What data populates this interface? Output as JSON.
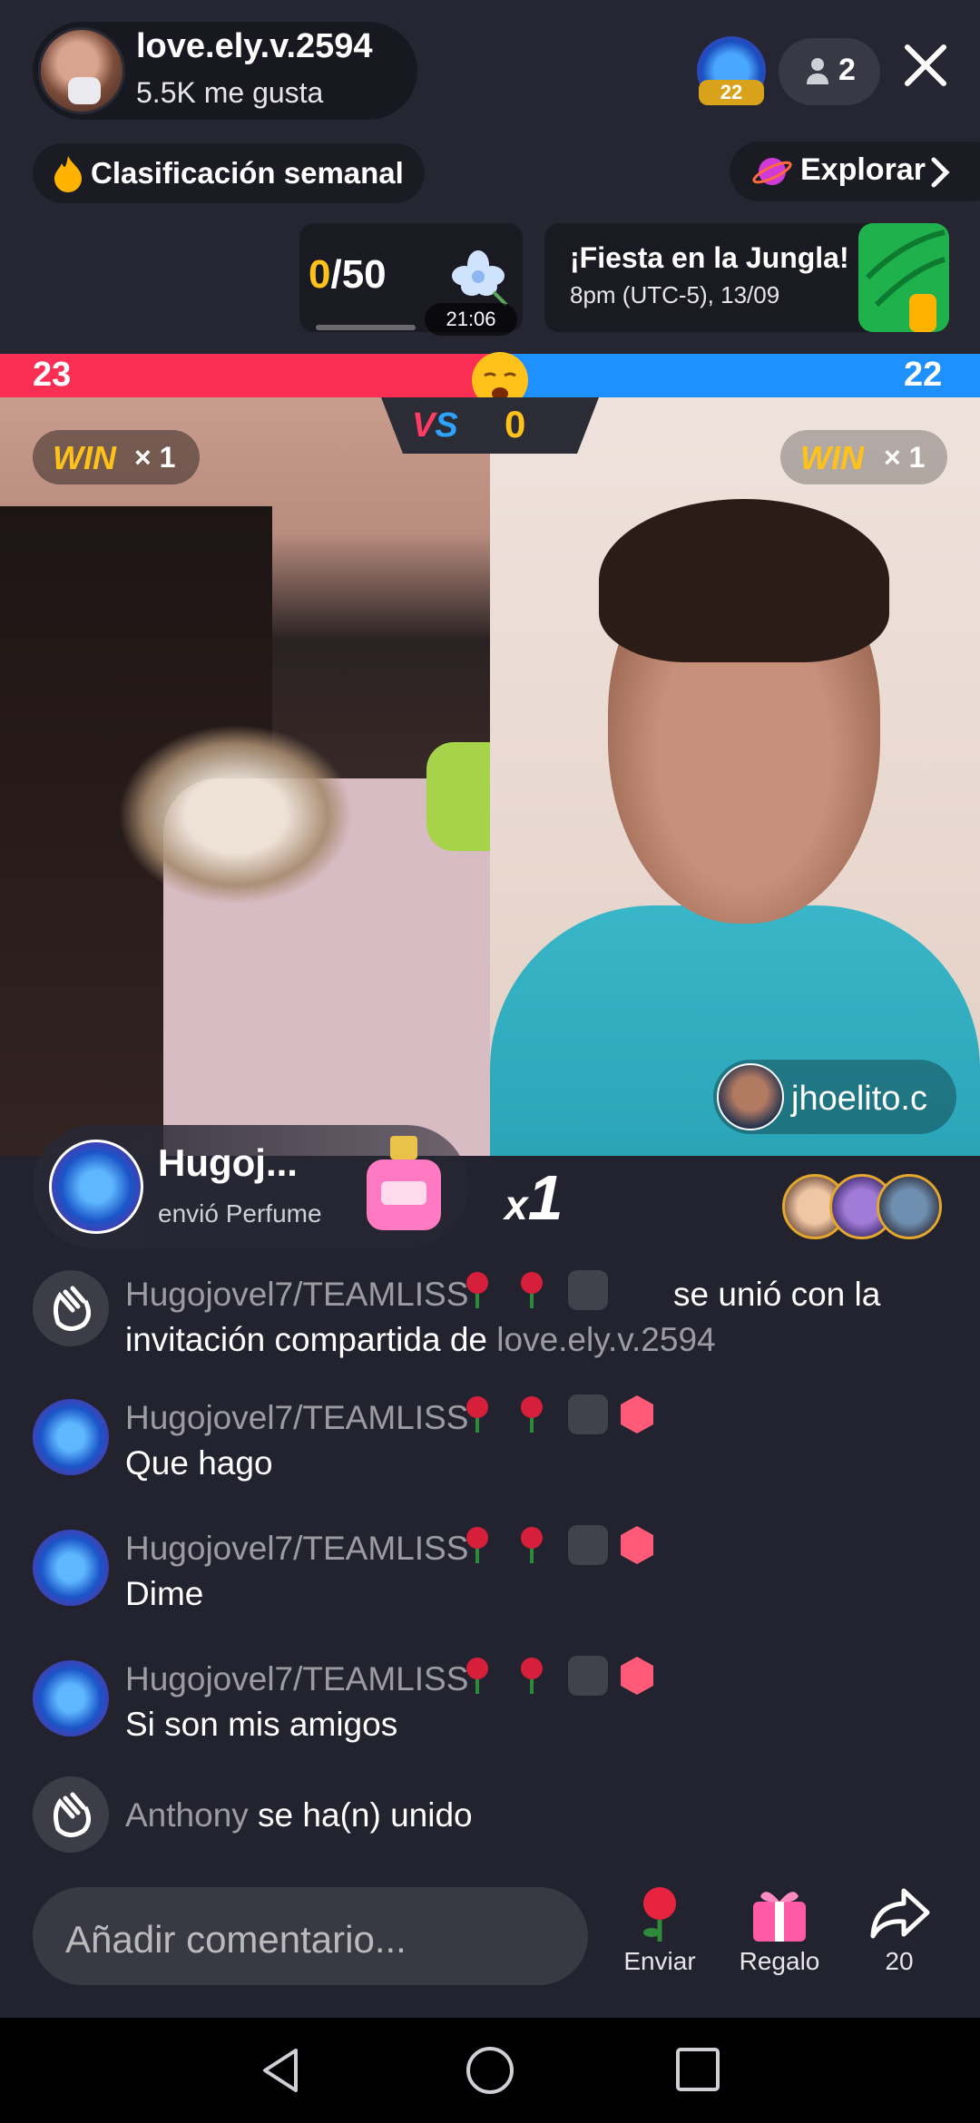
{
  "host": {
    "name": "love.ely.v.2594",
    "likes": "5.5K me gusta"
  },
  "header": {
    "badge_level": "22",
    "viewer_count": "2"
  },
  "ranking": {
    "label": "Clasificación semanal"
  },
  "explore": {
    "label": "Explorar"
  },
  "goal": {
    "current": "0",
    "total": "/50",
    "timer": "21:06",
    "progress_fraction": 0.0
  },
  "event": {
    "title": "¡Fiesta en la Jungla!",
    "date": "8pm (UTC-5), 13/09"
  },
  "battle": {
    "score_left": "23",
    "score_right": "22",
    "vs_label_v": "V",
    "vs_label_s": "S",
    "vs_points": "0",
    "colors": {
      "left": "#fb2f54",
      "right": "#1e90ff",
      "gold": "#ffc21a"
    },
    "win_left_word": "WIN",
    "win_left_mult": "× 1",
    "win_right_word": "WIN",
    "win_right_mult": "× 1",
    "guest_name": "jhoelito.c"
  },
  "gift": {
    "sender": "Hugoj...",
    "description": "envió Perfume",
    "multiplier_x": "x",
    "multiplier_n": "1"
  },
  "chat": [
    {
      "user": "Hugojovel7/TEAMLISS",
      "text": "se unió con la",
      "text2": "invitación compartida de ",
      "link": "love.ely.v.2594"
    },
    {
      "user": "Hugojovel7/TEAMLISS",
      "text": "Que hago"
    },
    {
      "user": "Hugojovel7/TEAMLISS",
      "text": "Dime"
    },
    {
      "user": "Hugojovel7/TEAMLISS",
      "text": "Si son mis amigos"
    },
    {
      "user": "Anthony",
      "text": " se ha(n) unido"
    }
  ],
  "bottom": {
    "comment_placeholder": "Añadir comentario...",
    "send_label": "Enviar",
    "gift_label": "Regalo",
    "share_count": "20"
  },
  "icons": [
    "flame-icon",
    "explore-planet-icon",
    "person-icon",
    "close-icon",
    "flower-icon",
    "leaf-icon",
    "wave-icon",
    "rose-icon",
    "gift-icon",
    "share-icon",
    "perfume-icon"
  ]
}
